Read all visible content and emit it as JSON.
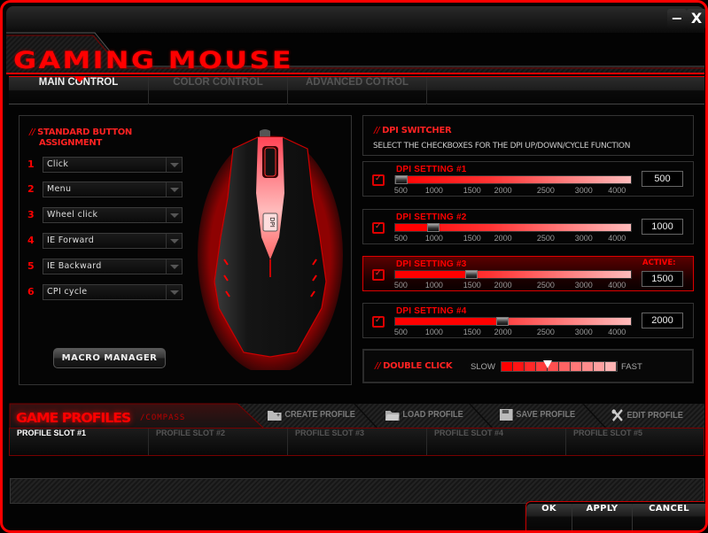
{
  "window": {
    "title": "GAMING MOUSE",
    "minimize_label": "−",
    "close_label": "X"
  },
  "tabs": [
    {
      "label": "MAIN CONTROL",
      "active": true
    },
    {
      "label": "COLOR CONTROL",
      "active": false
    },
    {
      "label": "ADVANCED COTROL",
      "active": false
    }
  ],
  "button_assignment": {
    "title_line1": "STANDARD BUTTON",
    "title_line2": "ASSIGNMENT",
    "slashes": "//",
    "buttons": [
      {
        "number": "1",
        "value": "Click"
      },
      {
        "number": "2",
        "value": "Menu"
      },
      {
        "number": "3",
        "value": "Wheel click"
      },
      {
        "number": "4",
        "value": "IE Forward"
      },
      {
        "number": "5",
        "value": "IE Backward"
      },
      {
        "number": "6",
        "value": "CPI cycle"
      }
    ],
    "macro_button": "MACRO MANAGER"
  },
  "mouse_image": {
    "dpi_label": "DPI"
  },
  "dpi_switcher": {
    "title": "DPI SWITCHER",
    "slashes": "//",
    "description": "SELECT THE CHECKBOXES FOR THE DPI UP/DOWN/CYCLE FUNCTION",
    "ticks": [
      "500",
      "1000",
      "1500",
      "2000",
      "2500",
      "3000",
      "4000"
    ],
    "active_label": "ACTIVE:",
    "settings": [
      {
        "label": "DPI SETTING #1",
        "value": "500",
        "checked": true,
        "active": false
      },
      {
        "label": "DPI SETTING #2",
        "value": "1000",
        "checked": true,
        "active": false
      },
      {
        "label": "DPI SETTING #3",
        "value": "1500",
        "checked": true,
        "active": true
      },
      {
        "label": "DPI SETTING #4",
        "value": "2000",
        "checked": true,
        "active": false
      }
    ]
  },
  "double_click": {
    "title": "DOUBLE CLICK",
    "slashes": "//",
    "slow_label": "SLOW",
    "fast_label": "FAST",
    "segments": 10,
    "level": 4
  },
  "profiles": {
    "title": "GAME PROFILES",
    "subtitle": "/COMPASS",
    "actions": [
      {
        "label": "CREATE PROFILE",
        "icon": "folder-add-icon"
      },
      {
        "label": "LOAD PROFILE",
        "icon": "folder-open-icon"
      },
      {
        "label": "SAVE PROFILE",
        "icon": "floppy-disk-icon"
      },
      {
        "label": "EDIT PROFILE",
        "icon": "tools-icon"
      }
    ],
    "slots": [
      {
        "label": "PROFILE SLOT #1",
        "active": true
      },
      {
        "label": "PROFILE SLOT #2",
        "active": false
      },
      {
        "label": "PROFILE SLOT #3",
        "active": false
      },
      {
        "label": "PROFILE SLOT #4",
        "active": false
      },
      {
        "label": "PROFILE SLOT #5",
        "active": false
      }
    ]
  },
  "footer": {
    "ok": "OK",
    "apply": "APPLY",
    "cancel": "CANCEL"
  },
  "colors": {
    "accent": "#ff0000",
    "background": "#000000",
    "inactive_text": "#555555"
  }
}
